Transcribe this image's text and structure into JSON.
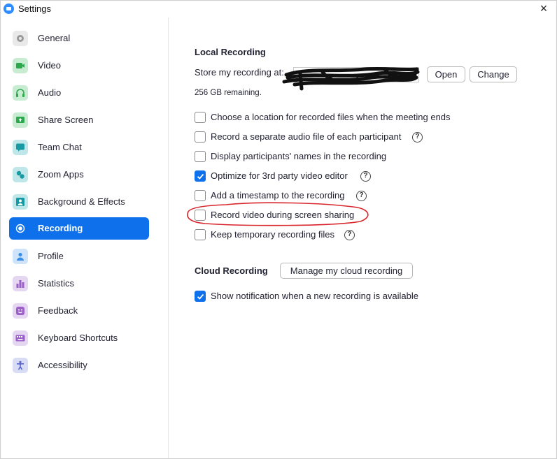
{
  "window": {
    "title": "Settings",
    "close_label": "×"
  },
  "sidebar": {
    "items": [
      {
        "label": "General",
        "icon": "gear-icon",
        "color": "#e9e9e9",
        "active": false
      },
      {
        "label": "Video",
        "icon": "video-camera-icon",
        "color": "#c8ecd2",
        "active": false
      },
      {
        "label": "Audio",
        "icon": "headphones-icon",
        "color": "#c8ecd2",
        "active": false
      },
      {
        "label": "Share Screen",
        "icon": "share-screen-icon",
        "color": "#c8ecd2",
        "active": false
      },
      {
        "label": "Team Chat",
        "icon": "chat-bubble-icon",
        "color": "#bfe6e8",
        "active": false
      },
      {
        "label": "Zoom Apps",
        "icon": "apps-icon",
        "color": "#bfe6e8",
        "active": false
      },
      {
        "label": "Background & Effects",
        "icon": "person-background-icon",
        "color": "#bfe6e8",
        "active": false
      },
      {
        "label": "Recording",
        "icon": "record-icon",
        "color": "#0e71eb",
        "active": true
      },
      {
        "label": "Profile",
        "icon": "profile-icon",
        "color": "#cfe3fb",
        "active": false
      },
      {
        "label": "Statistics",
        "icon": "bar-chart-icon",
        "color": "#e5d6f2",
        "active": false
      },
      {
        "label": "Feedback",
        "icon": "smiley-icon",
        "color": "#e5d6f2",
        "active": false
      },
      {
        "label": "Keyboard Shortcuts",
        "icon": "keyboard-icon",
        "color": "#e5d6f2",
        "active": false
      },
      {
        "label": "Accessibility",
        "icon": "accessibility-icon",
        "color": "#d8dcf5",
        "active": false
      }
    ]
  },
  "local_recording": {
    "title": "Local Recording",
    "store_label": "Store my recording at:",
    "open_button": "Open",
    "change_button": "Change",
    "space_remaining": "256 GB remaining.",
    "options": [
      {
        "label": "Choose a location for recorded files when the meeting ends",
        "checked": false,
        "help": false
      },
      {
        "label": "Record a separate audio file of each participant",
        "checked": false,
        "help": true
      },
      {
        "label": "Display participants' names in the recording",
        "checked": false,
        "help": false
      },
      {
        "label": "Optimize for 3rd party video editor",
        "checked": true,
        "help": true
      },
      {
        "label": "Add a timestamp to the recording",
        "checked": false,
        "help": true
      },
      {
        "label": "Record video during screen sharing",
        "checked": false,
        "help": false
      },
      {
        "label": "Keep temporary recording files",
        "checked": false,
        "help": true
      }
    ]
  },
  "cloud_recording": {
    "title": "Cloud Recording",
    "manage_button": "Manage my cloud recording",
    "options": [
      {
        "label": "Show notification when a new recording is available",
        "checked": true
      }
    ]
  },
  "help_glyph": "?",
  "colors": {
    "accent": "#0e71eb",
    "annotation": "#d9262c",
    "redaction": "#111111"
  }
}
